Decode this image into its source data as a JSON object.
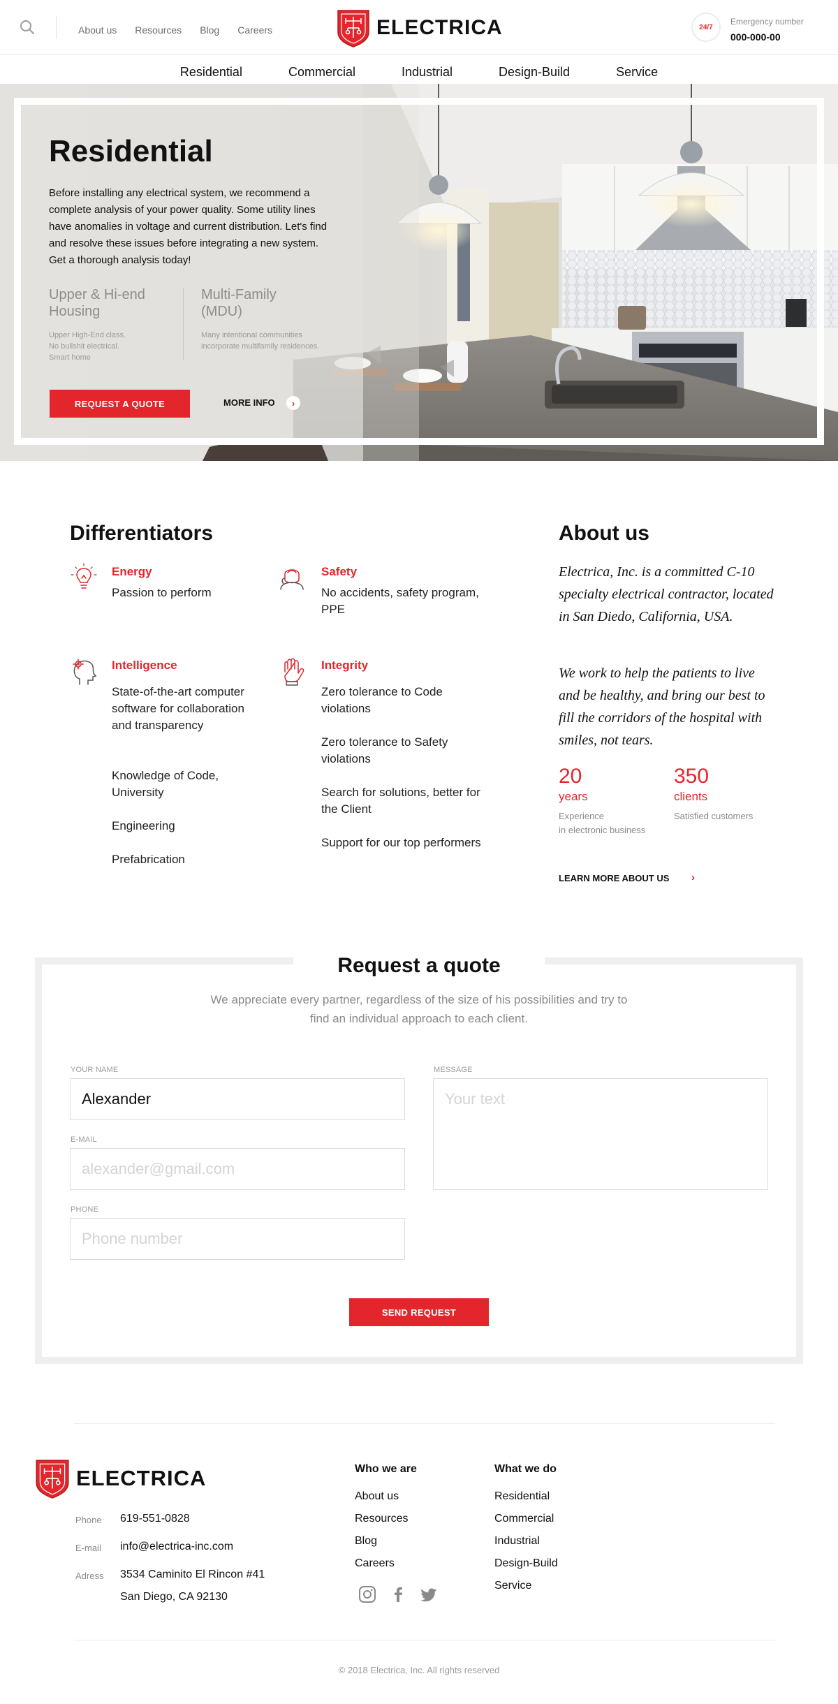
{
  "header": {
    "top_links": [
      "About us",
      "Resources",
      "Blog",
      "Careers"
    ],
    "brand": "ELECTRICA",
    "emergency_badge": "24/7",
    "emergency_label": "Emergency number",
    "emergency_number": "000-000-00"
  },
  "main_nav": [
    "Residential",
    "Commercial",
    "Industrial",
    "Design-Build",
    "Service"
  ],
  "hero": {
    "title": "Residential",
    "description": "Before installing any electrical system, we recommend a complete analysis of your power quality. Some utility lines have anomalies in voltage and current distribution. Let's find and resolve these issues before integrating a new system. Get a thorough analysis today!",
    "features": [
      {
        "title": "Upper & Hi-end Housing",
        "text": "Upper High-End class. No bullshit electrical. Smart home"
      },
      {
        "title": "Multi-Family (MDU)",
        "text": "Many intentional communities incorporate multifamily residences."
      }
    ],
    "cta_label": "REQUEST A QUOTE",
    "more_label": "MORE INFO"
  },
  "differentiators": {
    "title": "Differentiators",
    "items": [
      {
        "head": "Energy",
        "icon": "lightbulb-icon",
        "lines": [
          "Passion to perform"
        ]
      },
      {
        "head": "Safety",
        "icon": "safety-icon",
        "lines": [
          "No accidents, safety program, PPE"
        ]
      },
      {
        "head": "Intelligence",
        "icon": "intelligence-icon",
        "lines": [
          "State-of-the-art computer software for collaboration and transparency",
          "Knowledge of Code, University",
          "Engineering",
          "Prefabrication"
        ]
      },
      {
        "head": "Integrity",
        "icon": "hand-icon",
        "lines": [
          "Zero tolerance to Code violations",
          "Zero tolerance to Safety violations",
          "Search for solutions, better for the Client",
          "Support for our top performers"
        ]
      }
    ]
  },
  "about": {
    "title": "About us",
    "p1": "Electrica, Inc. is a committed C-10 specialty electrical contractor, located in San Diedo, California, USA.",
    "p2": "We work to help the patients to live and be healthy, and bring our best to fill the corridors of the hospital with smiles, not tears.",
    "stats": [
      {
        "number": "20",
        "unit": "years",
        "desc_1": "Experience",
        "desc_2": "in electronic business"
      },
      {
        "number": "350",
        "unit": "clients",
        "desc_1": "Satisfied customers",
        "desc_2": ""
      }
    ],
    "link_label": "LEARN MORE ABOUT US"
  },
  "quote": {
    "title": "Request a quote",
    "subtitle": "We appreciate every partner, regardless of the size of his possibilities and try to find an individual approach to each client.",
    "name_label": "YOUR NAME",
    "name_value": "Alexander",
    "email_label": "E-MAIL",
    "email_placeholder": "alexander@gmail.com",
    "phone_label": "PHONE",
    "phone_placeholder": "Phone number",
    "message_label": "MESSAGE",
    "message_placeholder": "Your text",
    "submit_label": "SEND REQUEST"
  },
  "footer": {
    "brand": "ELECTRICA",
    "phone_label": "Phone",
    "phone": "619-551-0828",
    "email_label": "E-mail",
    "email": "info@electrica-inc.com",
    "address_label": "Adress",
    "address_1": "3534 Caminito El Rincon #41",
    "address_2": "San Diego, CA 92130",
    "who_title": "Who we are",
    "who_links": [
      "About us",
      "Resources",
      "Blog",
      "Careers"
    ],
    "what_title": "What we do",
    "what_links": [
      "Residential",
      "Commercial",
      "Industrial",
      "Design-Build",
      "Service"
    ],
    "social": [
      "instagram-icon",
      "facebook-icon",
      "twitter-icon"
    ],
    "copyright": "© 2018 Electrica, Inc. All rights reserved"
  },
  "colors": {
    "accent": "#e2262b",
    "text": "#111111",
    "muted": "#8a8a8a",
    "border": "#efefef"
  }
}
